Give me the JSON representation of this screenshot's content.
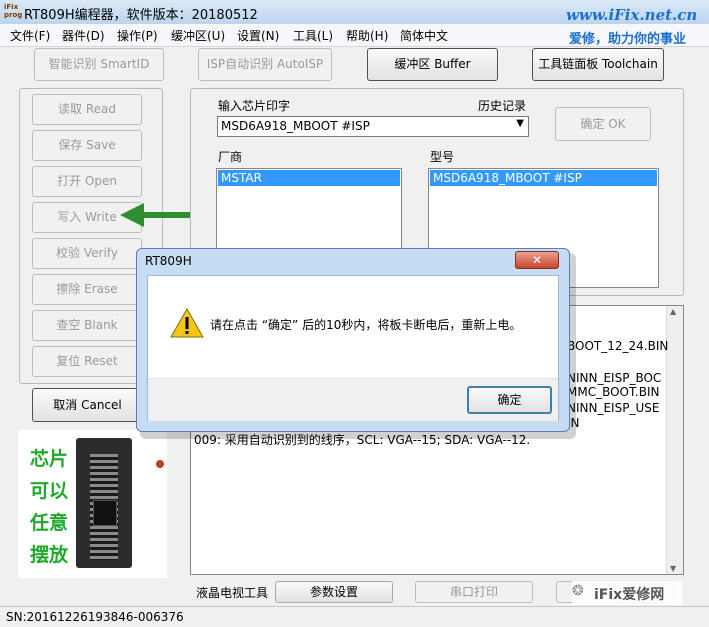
{
  "window": {
    "title": "RT809H编程器，软件版本：20180512",
    "icon_text": "iFix prog",
    "brand": "www.iFix.net.cn",
    "slogan": "爱修，助力你的事业"
  },
  "menu": [
    "文件(F)",
    "器件(D)",
    "操作(P)",
    "缓冲区(U)",
    "设置(N)",
    "工具(L)",
    "帮助(H)",
    "简体中文"
  ],
  "toolbar": {
    "smart_id": "智能识别 SmartID",
    "isp_auto": "ISP自动识别 AutoISP",
    "buffer": "缓冲区 Buffer",
    "toolchain": "工具链面板 Toolchain"
  },
  "actions": [
    "读取 Read",
    "保存 Save",
    "打开 Open",
    "写入 Write",
    "校验 Verify",
    "擦除 Erase",
    "查空 Blank",
    "复位 Reset"
  ],
  "cancel_label": "取消 Cancel",
  "chip_input": {
    "label": "输入芯片印字",
    "history_label": "历史记录",
    "value": "MSD6A918_MBOOT #ISP",
    "ok_label": "确定 OK"
  },
  "vendor": {
    "label": "厂商",
    "items": [
      "MSTAR"
    ]
  },
  "model": {
    "label": "型号",
    "items": [
      "MSD6A918_MBOOT #ISP"
    ]
  },
  "log": {
    "partial_lines": [
      "BOOT_12_24.BIN",
      "NINN_EISP_BOC",
      "MMC_BOOT.BIN",
      "NINN_EISP_USE",
      "IN"
    ],
    "line_009": "009: 采用自动识别到的线序，SCL: VGA--15; SDA: VGA--12."
  },
  "chip_hint": [
    "芯片",
    "可以",
    "任意",
    "摆放"
  ],
  "bottom": {
    "lcd_tools": "液晶电视工具",
    "params": "参数设置",
    "serial_print": "串口打印",
    "watermark": "iFix爱修网"
  },
  "status": {
    "sn": "SN:20161226193846-006376"
  },
  "dialog": {
    "title": "RT809H",
    "message": "请在点击 “确定” 后的10秒内，将板卡断电后，重新上电。",
    "ok": "确定"
  },
  "colors": {
    "accent": "#1e6fd0",
    "selection": "#3399ff",
    "chip_text": "#1fa82a",
    "arrow": "#2f8f2f"
  }
}
